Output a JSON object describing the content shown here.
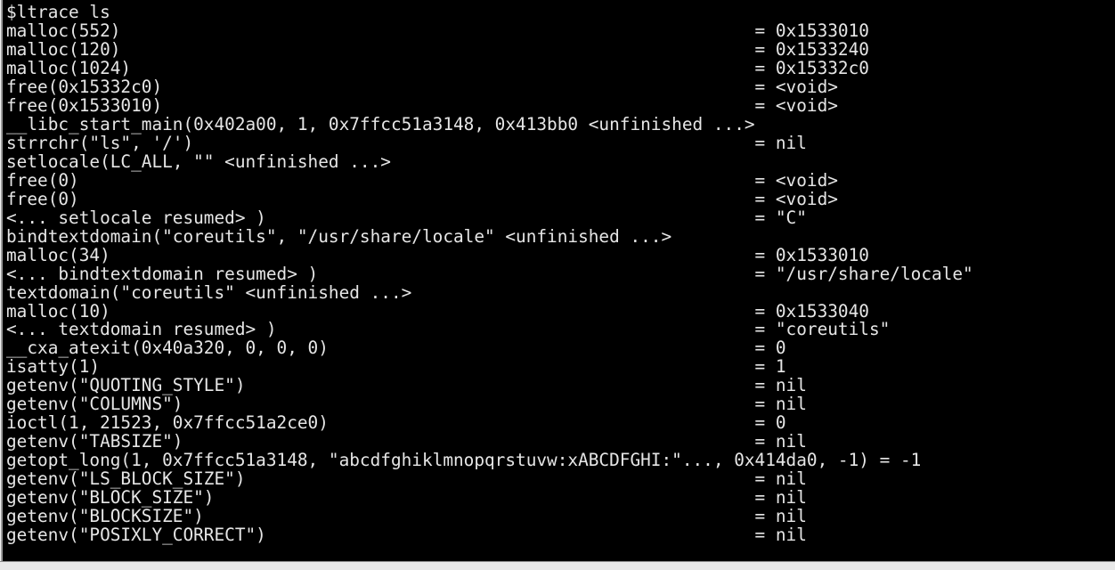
{
  "window": {
    "kind": "terminal-emulator",
    "background_color": "#000000",
    "foreground_color": "#e6e6e6",
    "border_color": "#e8e8e8",
    "columns": 93,
    "rows": 30
  },
  "terminal": {
    "prompt": "$",
    "command": "ltrace ls",
    "prompt_line": "$ltrace ls",
    "return_column": 72,
    "lines": [
      "$ltrace ls",
      "malloc(552)                                                             = 0x1533010",
      "malloc(120)                                                             = 0x1533240",
      "malloc(1024)                                                            = 0x15332c0",
      "free(0x15332c0)                                                         = <void>",
      "free(0x1533010)                                                         = <void>",
      "__libc_start_main(0x402a00, 1, 0x7ffcc51a3148, 0x413bb0 <unfinished ...>",
      "strrchr(\"ls\", '/')                                                      = nil",
      "setlocale(LC_ALL, \"\" <unfinished ...>",
      "free(0)                                                                 = <void>",
      "free(0)                                                                 = <void>",
      "<... setlocale resumed> )                                               = \"C\"",
      "bindtextdomain(\"coreutils\", \"/usr/share/locale\" <unfinished ...>",
      "malloc(34)                                                              = 0x1533010",
      "<... bindtextdomain resumed> )                                          = \"/usr/share/locale\"",
      "textdomain(\"coreutils\" <unfinished ...>",
      "malloc(10)                                                              = 0x1533040",
      "<... textdomain resumed> )                                              = \"coreutils\"",
      "__cxa_atexit(0x40a320, 0, 0, 0)                                         = 0",
      "isatty(1)                                                               = 1",
      "getenv(\"QUOTING_STYLE\")                                                 = nil",
      "getenv(\"COLUMNS\")                                                       = nil",
      "ioctl(1, 21523, 0x7ffcc51a2ce0)                                         = 0",
      "getenv(\"TABSIZE\")                                                       = nil",
      "getopt_long(1, 0x7ffcc51a3148, \"abcdfghiklmnopqrstuvw:xABCDFGHI:\"..., 0x414da0, -1) = -1",
      "getenv(\"LS_BLOCK_SIZE\")                                                 = nil",
      "getenv(\"BLOCK_SIZE\")                                                    = nil",
      "getenv(\"BLOCKSIZE\")                                                     = nil",
      "getenv(\"POSIXLY_CORRECT\")                                               = nil"
    ],
    "calls": [
      {
        "call": "malloc(552)",
        "result": "0x1533010"
      },
      {
        "call": "malloc(120)",
        "result": "0x1533240"
      },
      {
        "call": "malloc(1024)",
        "result": "0x15332c0"
      },
      {
        "call": "free(0x15332c0)",
        "result": "<void>"
      },
      {
        "call": "free(0x1533010)",
        "result": "<void>"
      },
      {
        "call": "__libc_start_main(0x402a00, 1, 0x7ffcc51a3148, 0x413bb0 <unfinished ...>",
        "result": ""
      },
      {
        "call": "strrchr(\"ls\", '/')",
        "result": "nil"
      },
      {
        "call": "setlocale(LC_ALL, \"\" <unfinished ...>",
        "result": ""
      },
      {
        "call": "free(0)",
        "result": "<void>"
      },
      {
        "call": "free(0)",
        "result": "<void>"
      },
      {
        "call": "<... setlocale resumed> )",
        "result": "\"C\""
      },
      {
        "call": "bindtextdomain(\"coreutils\", \"/usr/share/locale\" <unfinished ...>",
        "result": ""
      },
      {
        "call": "malloc(34)",
        "result": "0x1533010"
      },
      {
        "call": "<... bindtextdomain resumed> )",
        "result": "\"/usr/share/locale\""
      },
      {
        "call": "textdomain(\"coreutils\" <unfinished ...>",
        "result": ""
      },
      {
        "call": "malloc(10)",
        "result": "0x1533040"
      },
      {
        "call": "<... textdomain resumed> )",
        "result": "\"coreutils\""
      },
      {
        "call": "__cxa_atexit(0x40a320, 0, 0, 0)",
        "result": "0"
      },
      {
        "call": "isatty(1)",
        "result": "1"
      },
      {
        "call": "getenv(\"QUOTING_STYLE\")",
        "result": "nil"
      },
      {
        "call": "getenv(\"COLUMNS\")",
        "result": "nil"
      },
      {
        "call": "ioctl(1, 21523, 0x7ffcc51a2ce0)",
        "result": "0"
      },
      {
        "call": "getenv(\"TABSIZE\")",
        "result": "nil"
      },
      {
        "call": "getopt_long(1, 0x7ffcc51a3148, \"abcdfghiklmnopqrstuvw:xABCDFGHI:\"..., 0x414da0, -1)",
        "result": "-1"
      },
      {
        "call": "getenv(\"LS_BLOCK_SIZE\")",
        "result": "nil"
      },
      {
        "call": "getenv(\"BLOCK_SIZE\")",
        "result": "nil"
      },
      {
        "call": "getenv(\"BLOCKSIZE\")",
        "result": "nil"
      },
      {
        "call": "getenv(\"POSIXLY_CORRECT\")",
        "result": "nil"
      }
    ]
  }
}
